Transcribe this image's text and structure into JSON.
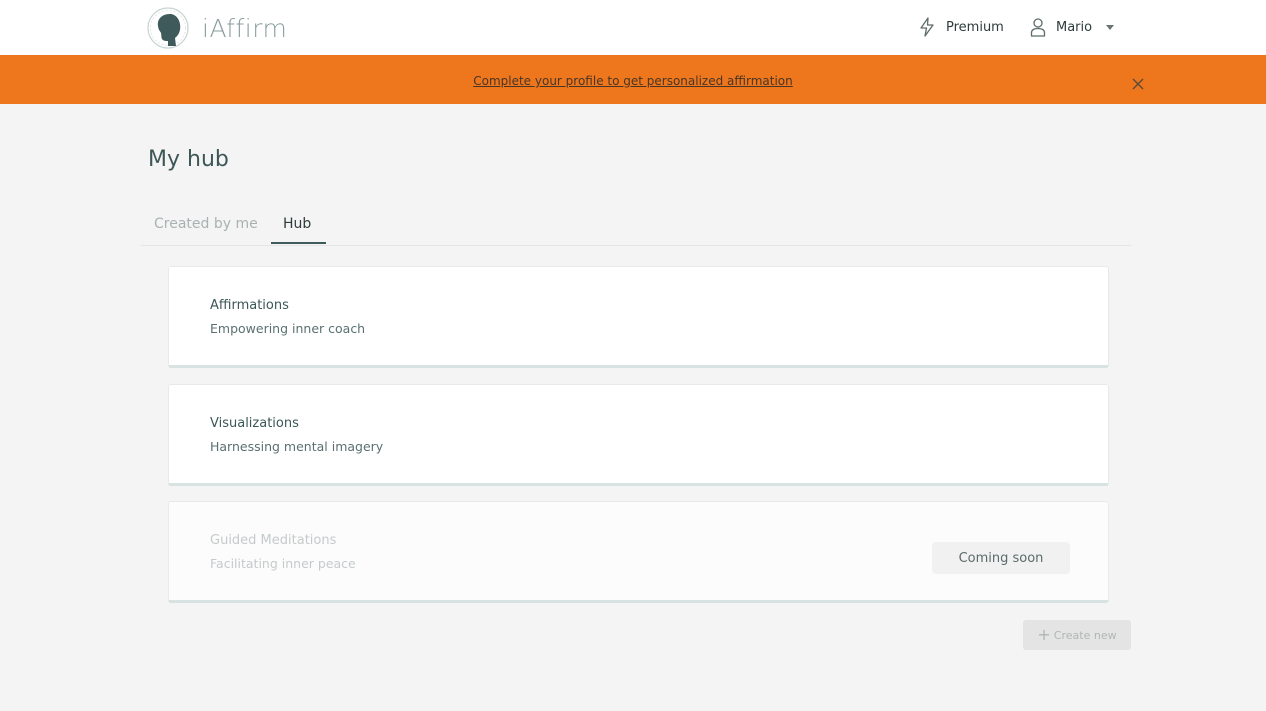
{
  "brand": {
    "name": "iAffirm",
    "logo_icon": "head-silhouette-icon"
  },
  "nav": {
    "premium_label": "Premium",
    "premium_icon": "lightning-icon",
    "user_label": "Mario",
    "user_icon": "user-icon",
    "dropdown_icon": "chevron-down-icon"
  },
  "banner": {
    "text": "Complete your profile to get personalized affirmation",
    "close_icon": "close-icon",
    "color": "#ee771d"
  },
  "page": {
    "title": "My hub"
  },
  "tabs": [
    {
      "label": "Created by me",
      "active": false
    },
    {
      "label": "Hub",
      "active": true
    }
  ],
  "cards": [
    {
      "title": "Affirmations",
      "subtitle": "Empowering inner coach",
      "disabled": false
    },
    {
      "title": "Visualizations",
      "subtitle": "Harnessing mental imagery",
      "disabled": false
    },
    {
      "title": "Guided Meditations",
      "subtitle": "Facilitating inner peace",
      "disabled": true,
      "badge": "Coming soon"
    }
  ],
  "actions": {
    "create_new": "Create new",
    "create_icon": "plus-icon"
  }
}
